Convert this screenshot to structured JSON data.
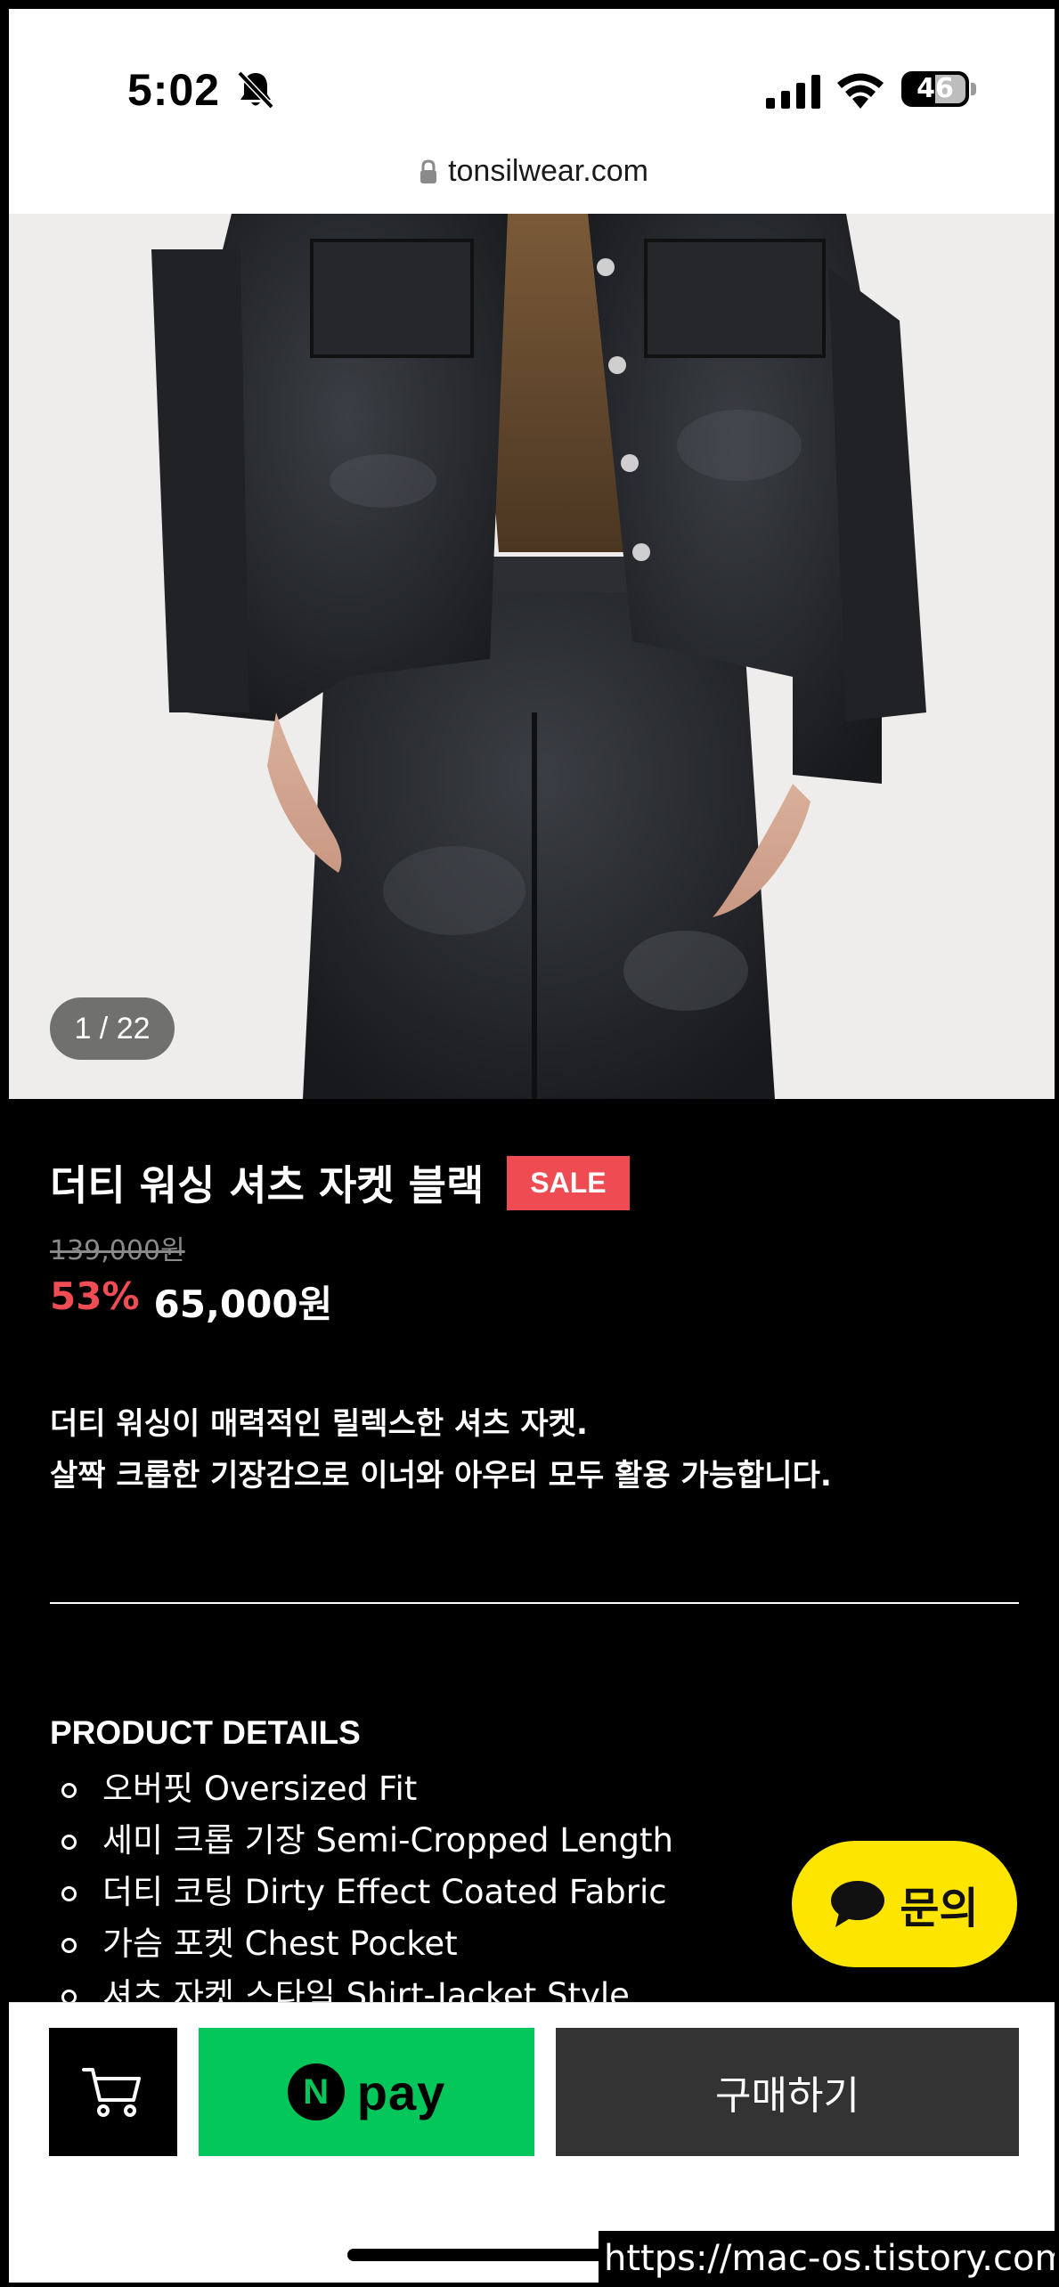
{
  "status_bar": {
    "time": "5:02",
    "battery": "46",
    "icons": [
      "bell-slash-icon",
      "signal-bars-icon",
      "wifi-icon",
      "battery-icon"
    ]
  },
  "browser": {
    "url": "tonsilwear.com",
    "lock_icon": "lock-icon"
  },
  "gallery": {
    "counter": "1 / 22"
  },
  "product": {
    "title": "더티 워싱 셔츠 자켓 블랙",
    "badge": "SALE",
    "original_price": "139,000원",
    "discount": "53%",
    "price": "65,000원",
    "description": [
      "더티 워싱이 매력적인 릴렉스한 셔츠 자켓.",
      "살짝 크롭한 기장감으로 이너와 아우터 모두 활용 가능합니다."
    ]
  },
  "details": {
    "heading": "PRODUCT DETAILS",
    "items": [
      "오버핏 Oversized Fit",
      "세미 크롭 기장 Semi-Cropped Length",
      "더티 코팅 Dirty Effect Coated Fabric",
      "가슴 포켓 Chest Pocket",
      "셔츠 자켓 스타일 Shirt-Jacket Style"
    ]
  },
  "chat": {
    "label": "문의",
    "icon": "chat-bubble-icon"
  },
  "bottom_bar": {
    "cart_icon": "cart-icon",
    "npay_n": "N",
    "npay_label": "pay",
    "buy_label": "구매하기"
  },
  "watermark": "https://mac-os.tistory.com",
  "colors": {
    "sale_red": "#ee4b53",
    "npay_green": "#03c75a",
    "chat_yellow": "#fee500",
    "buy_dark": "#333333"
  }
}
